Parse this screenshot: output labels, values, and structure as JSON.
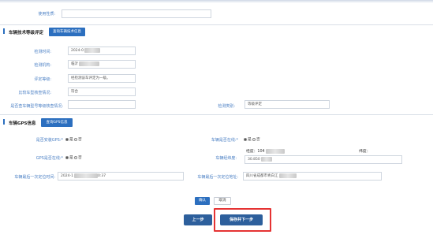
{
  "top": {
    "usage_label": "使用性质:"
  },
  "tech": {
    "title": "车辆技术等级评定",
    "query_btn": "查询车辆技术信息",
    "check_time_label": "检测时间:",
    "check_time_value": "2024-0",
    "check_org_label": "检测机构:",
    "check_org_value": "临沂",
    "grade_label": "评定等级:",
    "grade_value": "经检测该车评定为一级。",
    "compare_label": "比较车型核查情况:",
    "compare_value": "符合",
    "query_model_label": "是否查车辆型号等级核查情况:",
    "level_label": "检测类别:",
    "level_value": "等级评定"
  },
  "gps": {
    "title": "车辆GPS信息",
    "query_btn": "查询GPS信息",
    "installed_label": "是否安装GPS:*",
    "online_label": "车辆是否在线:*",
    "gps_online_label": "GPS是否在线:*",
    "latlng_label": "车辆经纬度:",
    "lng_prefix": "经度：104",
    "lat_prefix": "纬度：",
    "lat_value": "30.850",
    "yes": "是",
    "no": "否",
    "last_time_label": "车辆最后一次定位时间:",
    "last_time_value": "2024-1",
    "last_time_suffix": "0:37",
    "last_addr_label": "车辆最后一次定位地址:",
    "last_addr_value": "四川省成都市青白江"
  },
  "actions": {
    "confirm": "确认",
    "cancel": "取消",
    "prev": "上一步",
    "save_next": "保存并下一步"
  },
  "colors": {
    "accent": "#2c6fbf",
    "primary_button": "#2d5f9c",
    "highlight": "#e53333"
  }
}
